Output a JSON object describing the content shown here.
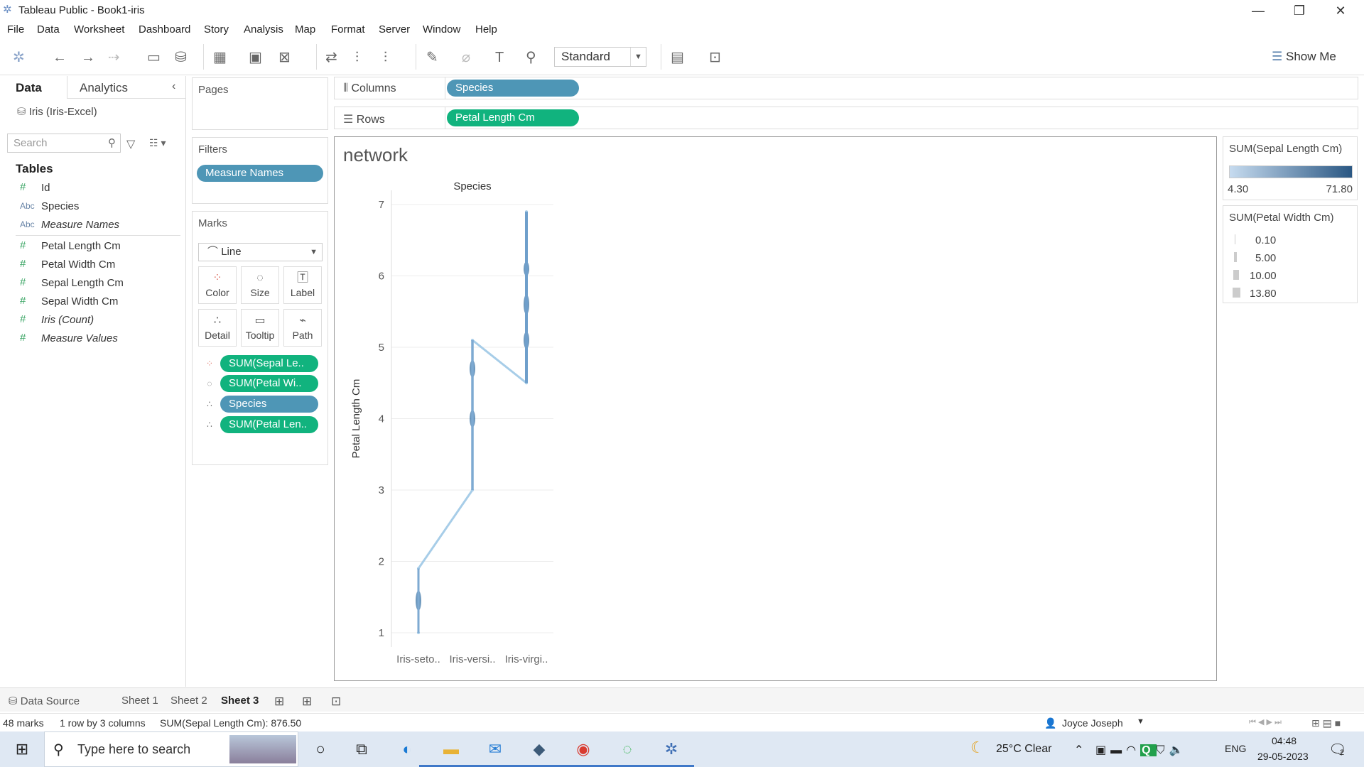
{
  "window": {
    "title": "Tableau Public - Book1-iris",
    "minimize": "—",
    "restore": "❐",
    "close": "✕"
  },
  "menu": [
    "File",
    "Data",
    "Worksheet",
    "Dashboard",
    "Story",
    "Analysis",
    "Map",
    "Format",
    "Server",
    "Window",
    "Help"
  ],
  "toolbar": {
    "fit_mode": "Standard",
    "show_me": "Show Me"
  },
  "left_pane": {
    "tab_data": "Data",
    "tab_analytics": "Analytics",
    "data_source": "Iris (Iris-Excel)",
    "search_placeholder": "Search",
    "tables_header": "Tables",
    "fields": [
      {
        "icon": "#",
        "name": "Id"
      },
      {
        "icon": "Abc",
        "name": "Species"
      },
      {
        "icon": "Abc",
        "name": "Measure Names"
      },
      {
        "icon": "#",
        "name": "Petal Length Cm"
      },
      {
        "icon": "#",
        "name": "Petal Width Cm"
      },
      {
        "icon": "#",
        "name": "Sepal Length Cm"
      },
      {
        "icon": "#",
        "name": "Sepal Width Cm"
      },
      {
        "icon": "#",
        "name": "Iris (Count)"
      },
      {
        "icon": "#",
        "name": "Measure Values"
      }
    ]
  },
  "pages": {
    "title": "Pages"
  },
  "filters": {
    "title": "Filters",
    "pills": [
      "Measure Names"
    ]
  },
  "marks": {
    "title": "Marks",
    "type": "Line",
    "buttons": [
      "Color",
      "Size",
      "Label",
      "Detail",
      "Tooltip",
      "Path"
    ],
    "pills": [
      "SUM(Sepal Le..",
      "SUM(Petal Wi..",
      "Species",
      "SUM(Petal Len.."
    ]
  },
  "shelves": {
    "columns_label": "Columns",
    "columns_pill": "Species",
    "rows_label": "Rows",
    "rows_pill": "Petal Length Cm"
  },
  "legend_color": {
    "title": "SUM(Sepal Length Cm)",
    "min": "4.30",
    "max": "71.80",
    "color_low": "#c6dbef",
    "color_high": "#2a5783"
  },
  "legend_size": {
    "title": "SUM(Petal Width Cm)",
    "items": [
      "0.10",
      "5.00",
      "10.00",
      "13.80"
    ]
  },
  "chart_data": {
    "type": "line",
    "title": "network",
    "column_header": "Species",
    "ylabel": "Petal Length Cm",
    "categories": [
      "Iris-seto..",
      "Iris-versi..",
      "Iris-virgi.."
    ],
    "yticks": [
      1,
      2,
      3,
      4,
      5,
      6,
      7
    ],
    "ylim": [
      0.9,
      7.1
    ],
    "path": [
      {
        "category": 0,
        "y": 1.0
      },
      {
        "category": 0,
        "y": 1.9
      },
      {
        "category": 1,
        "y": 3.0
      },
      {
        "category": 1,
        "y": 5.1
      },
      {
        "category": 2,
        "y": 4.5
      },
      {
        "category": 2,
        "y": 6.9
      }
    ],
    "line_color": "#a7cde8",
    "dense_color": "#3f77a8"
  },
  "sheet_tabs": {
    "data_source": "Data Source",
    "sheets": [
      "Sheet 1",
      "Sheet 2",
      "Sheet 3"
    ],
    "active": "Sheet 3"
  },
  "status": {
    "marks": "48 marks",
    "dims": "1 row by 3 columns",
    "sum": "SUM(Sepal Length Cm): 876.50",
    "user": "Joyce Joseph"
  },
  "taskbar": {
    "search_placeholder": "Type here to search",
    "weather": "25°C  Clear",
    "lang": "ENG",
    "time": "04:48",
    "date": "29-05-2023",
    "notif": "2"
  }
}
